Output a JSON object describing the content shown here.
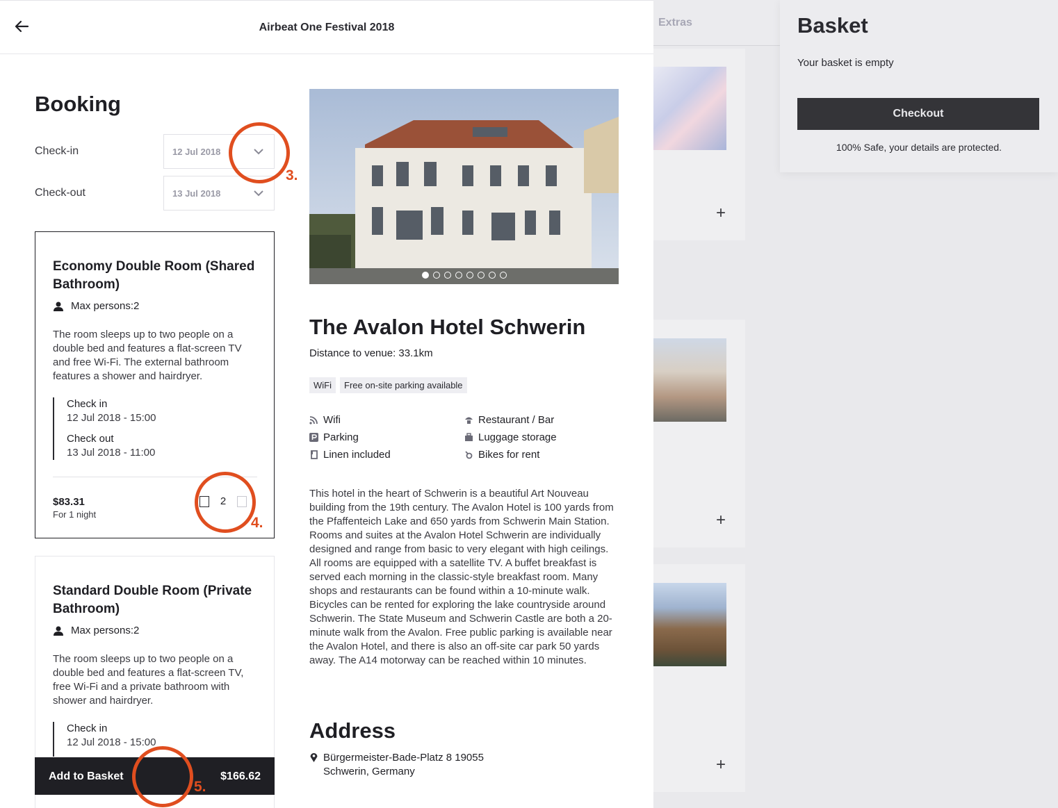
{
  "topbar": {
    "title": "Airbeat One Festival 2018"
  },
  "booking": {
    "title": "Booking",
    "checkin_label": "Check-in",
    "checkin_value": "12 Jul 2018",
    "checkout_label": "Check-out",
    "checkout_value": "13 Jul 2018"
  },
  "rooms": [
    {
      "name": "Economy Double Room (Shared Bathroom)",
      "max_persons": "Max persons:2",
      "description": "The room sleeps up to two people on a double bed and features a flat-screen TV and free Wi-Fi. The external bathroom features a shower and hairdryer.",
      "checkin_heading": "Check in",
      "checkin_value": "12 Jul 2018 - 15:00",
      "checkout_heading": "Check out",
      "checkout_value": "13 Jul 2018 - 11:00",
      "price": "$83.31",
      "price_sub": "For 1 night",
      "quantity": "2"
    },
    {
      "name": "Standard Double Room (Private Bathroom)",
      "max_persons": "Max persons:2",
      "description": "The room sleeps up to two people on a double bed and features a flat-screen TV, free Wi-Fi and a private bathroom with shower and hairdryer.",
      "checkin_heading": "Check in",
      "checkin_value": "12 Jul 2018 - 15:00"
    }
  ],
  "add_to_basket": {
    "label": "Add to Basket",
    "total": "$166.62"
  },
  "annotations": [
    "3.",
    "4.",
    "5."
  ],
  "hotel": {
    "name": "The Avalon Hotel Schwerin",
    "distance": "Distance to venue: 33.1km",
    "tags": [
      "WiFi",
      "Free on-site parking available"
    ],
    "facilities": [
      {
        "label": "Wifi",
        "icon": "wifi-icon"
      },
      {
        "label": "Restaurant / Bar",
        "icon": "restaurant-icon"
      },
      {
        "label": "Parking",
        "icon": "parking-icon"
      },
      {
        "label": "Luggage storage",
        "icon": "luggage-icon"
      },
      {
        "label": "Linen included",
        "icon": "linen-icon"
      },
      {
        "label": "Bikes for rent",
        "icon": "bike-icon"
      }
    ],
    "description": "This hotel in the heart of Schwerin is a beautiful Art Nouveau building from the 19th century. The Avalon Hotel is 100 yards from the Pfaffenteich Lake and 650 yards from Schwerin Main Station. Rooms and suites at the Avalon Hotel Schwerin are individually designed and range from basic to very elegant with high ceilings. All rooms are equipped with a satellite TV. A buffet breakfast is served each morning in the classic-style breakfast room. Many shops and restaurants can be found within a 10-minute walk. Bicycles can be rented for exploring the lake countryside around Schwerin. The State Museum and Schwerin Castle are both a 20-minute walk from the Avalon. Free public parking is available near the Avalon Hotel, and there is also an off-site car park 50 yards away. The A14 motorway can be reached within 10 minutes.",
    "address_title": "Address",
    "address_line1": "Bürgermeister-Bade-Platz 8 19055",
    "address_line2": "Schwerin, Germany",
    "gallery_total": 8,
    "gallery_active": 1
  },
  "background": {
    "tab_extras": "Extras",
    "plus_symbol": "+"
  },
  "basket": {
    "title": "Basket",
    "empty_text": "Your basket is empty",
    "checkout_label": "Checkout",
    "safe_text": "100% Safe, your details are protected."
  },
  "colors": {
    "accent_annotation": "#e04e1f",
    "dark": "#1f1f24",
    "checkout_bg": "#343438"
  }
}
